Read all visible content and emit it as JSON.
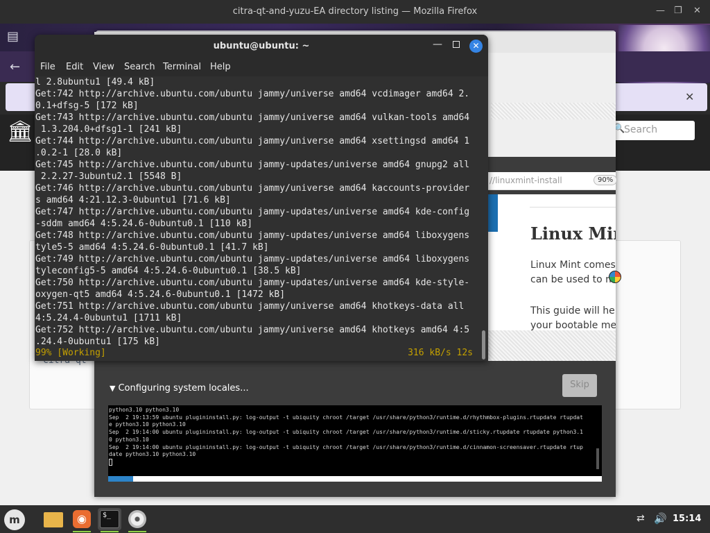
{
  "firefox": {
    "window_title": "citra-qt-and-yuzu-EA directory listing — Mozilla Firefox",
    "search_placeholder": "Search",
    "close_glyph": "✕",
    "listing_fragment": "citra-qt-"
  },
  "installer": {
    "url_fragment": "//linuxmint-install",
    "zoom": "90%",
    "guide": {
      "title": "Linux Mint",
      "lines": [
        "Linux Mint comes i",
        "can be used to ma",
        "This guide will help",
        "your bootable medi"
      ]
    },
    "status": "Configuring system locales...",
    "skip_label": "Skip",
    "log_lines": [
      "python3.10 python3.10",
      "Sep  2 19:13:59 ubuntu plugininstall.py: log-output -t ubiquity chroot /target /usr/share/python3/runtime.d/rhythmbox-plugins.rtupdate rtupdat",
      "e python3.10 python3.10",
      "Sep  2 19:14:00 ubuntu plugininstall.py: log-output -t ubiquity chroot /target /usr/share/python3/runtime.d/sticky.rtupdate rtupdate python3.1",
      "0 python3.10",
      "Sep  2 19:14:00 ubuntu plugininstall.py: log-output -t ubiquity chroot /target /usr/share/python3/runtime.d/cinnamon-screensaver.rtupdate rtup",
      "date python3.10 python3.10"
    ],
    "progress_percent": 5
  },
  "terminal": {
    "title": "ubuntu@ubuntu: ~",
    "menu": [
      "File",
      "Edit",
      "View",
      "Search",
      "Terminal",
      "Help"
    ],
    "lines": [
      "l 2.8ubuntu1 [49.4 kB]",
      "Get:742 http://archive.ubuntu.com/ubuntu jammy/universe amd64 vcdimager amd64 2.",
      "0.1+dfsg-5 [172 kB]",
      "Get:743 http://archive.ubuntu.com/ubuntu jammy/universe amd64 vulkan-tools amd64",
      " 1.3.204.0+dfsg1-1 [241 kB]",
      "Get:744 http://archive.ubuntu.com/ubuntu jammy/universe amd64 xsettingsd amd64 1",
      ".0.2-1 [28.0 kB]",
      "Get:745 http://archive.ubuntu.com/ubuntu jammy-updates/universe amd64 gnupg2 all",
      " 2.2.27-3ubuntu2.1 [5548 B]",
      "Get:746 http://archive.ubuntu.com/ubuntu jammy/universe amd64 kaccounts-provider",
      "s amd64 4:21.12.3-0ubuntu1 [71.6 kB]",
      "Get:747 http://archive.ubuntu.com/ubuntu jammy-updates/universe amd64 kde-config",
      "-sddm amd64 4:5.24.6-0ubuntu0.1 [110 kB]",
      "Get:748 http://archive.ubuntu.com/ubuntu jammy-updates/universe amd64 liboxygens",
      "tyle5-5 amd64 4:5.24.6-0ubuntu0.1 [41.7 kB]",
      "Get:749 http://archive.ubuntu.com/ubuntu jammy-updates/universe amd64 liboxygens",
      "tyleconfig5-5 amd64 4:5.24.6-0ubuntu0.1 [38.5 kB]",
      "Get:750 http://archive.ubuntu.com/ubuntu jammy-updates/universe amd64 kde-style-",
      "oxygen-qt5 amd64 4:5.24.6-0ubuntu0.1 [1472 kB]",
      "Get:751 http://archive.ubuntu.com/ubuntu jammy/universe amd64 khotkeys-data all",
      "4:5.24.4-0ubuntu1 [1711 kB]",
      "Get:752 http://archive.ubuntu.com/ubuntu jammy/universe amd64 khotkeys amd64 4:5",
      ".24.4-0ubuntu1 [175 kB]"
    ],
    "status_left": "99% [Working]",
    "status_right": "316 kB/s 12s"
  },
  "taskbar": {
    "clock": "15:14",
    "apps": [
      "mint-menu-icon",
      "files-icon",
      "firefox-icon",
      "terminal-icon",
      "disc-icon"
    ]
  },
  "colors": {
    "terminal_bg": "#303030",
    "terminal_status": "#c4a000",
    "accent_blue": "#3584e4",
    "progress_fill": "#2d84c9"
  }
}
